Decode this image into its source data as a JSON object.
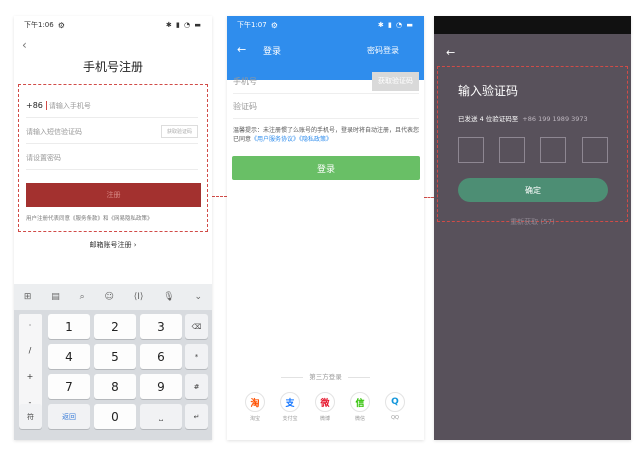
{
  "colors": {
    "accent_red": "#a3312f",
    "annotation_dashes": "#d14b47",
    "blue_header": "#2f8ded",
    "login_green": "#69bf66",
    "confirm_green": "#4d8e74",
    "dark_background": "#58515b"
  },
  "screen1": {
    "status_time": "下午1:06",
    "title": "手机号注册",
    "country_code": "+86",
    "phone_placeholder": "请输入手机号",
    "code_placeholder": "请输入短信验证码",
    "code_button": "获取验证码",
    "password_placeholder": "请设置密码",
    "register_button": "注册",
    "terms": "用户注册代表同意《服务条款》和《网易隐私政策》",
    "email_register": "邮箱账号注册",
    "keyboard": {
      "toolbar_icons": [
        "keyboard-grid-icon",
        "clipboard-icon",
        "search-icon",
        "emoji-icon",
        "cursor-icon",
        "mic-icon",
        "collapse-icon"
      ],
      "side_keys": [
        "·",
        "/",
        "+",
        "-"
      ],
      "rows": [
        [
          "1",
          "2",
          "3"
        ],
        [
          "4",
          "5",
          "6"
        ],
        [
          "7",
          "8",
          "9"
        ]
      ],
      "right_keys": [
        "⌫",
        "*",
        "#"
      ],
      "bottom": {
        "symbols": "符",
        "back": "返回",
        "zero": "0",
        "space": "⎵",
        "enter": "↵"
      }
    }
  },
  "screen2": {
    "status_time": "下午1:07",
    "title": "登录",
    "password_login": "密码登录",
    "phone_label": "手机号",
    "get_code_button": "获取验证码",
    "code_label": "验证码",
    "tip_text": "温馨提示：未注册惯了么账号的手机号，登录时将自动注册，且代表您已同意",
    "tip_links": "《用户服务协议》《隐私政策》",
    "login_button": "登录",
    "third_party_label": "第三方登录",
    "social": [
      {
        "label": "淘宝",
        "glyph": "淘",
        "color": "#ff5000"
      },
      {
        "label": "支付宝",
        "glyph": "支",
        "color": "#1677ff"
      },
      {
        "label": "微博",
        "glyph": "微",
        "color": "#e6162d"
      },
      {
        "label": "微信",
        "glyph": "信",
        "color": "#2dc100"
      },
      {
        "label": "QQ",
        "glyph": "Q",
        "color": "#1296db"
      }
    ]
  },
  "screen3": {
    "title": "输入验证码",
    "sent_text": "已发送 4 位验证码至",
    "phone_number": "+86 199 1989 3973",
    "confirm_button": "确定",
    "resend": "重新获取 (57)"
  }
}
